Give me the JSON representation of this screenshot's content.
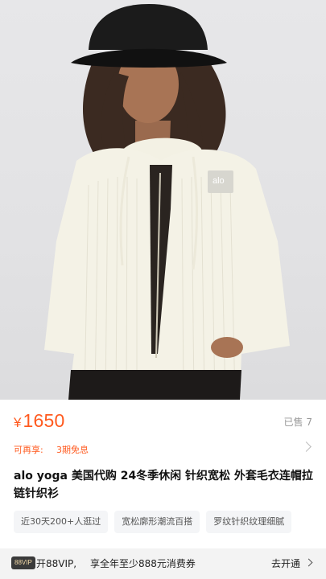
{
  "product": {
    "logo_text": "alo",
    "image_alt": "Model wearing white ribbed knit zip-up hoodie and black bucket hat"
  },
  "price": {
    "currency": "¥",
    "amount": "1650",
    "sold_text": "已售 7"
  },
  "promo": {
    "label": "可再享:",
    "value": "3期免息"
  },
  "title": "alo yoga 美国代购 24冬季休闲 针织宽松 外套毛衣连帽拉链针织衫",
  "tags": [
    "近30天200+人逛过",
    "宽松廓形潮流百搭",
    "罗纹针织纹理细腻"
  ],
  "vip": {
    "badge": "88VIP",
    "open_text": "开88VIP,",
    "desc": "享全年至少888元消费券",
    "cta": "去开通"
  },
  "colors": {
    "accent": "#ff5a1f",
    "vip_badge_bg": "#3a3a3a",
    "vip_badge_text": "#f2d9a8"
  }
}
